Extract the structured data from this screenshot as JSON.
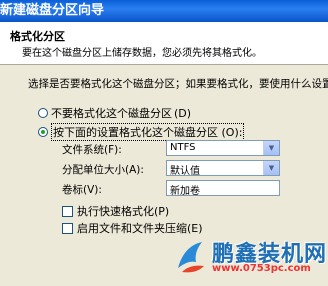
{
  "window": {
    "title": "新建磁盘分区向导"
  },
  "header": {
    "title": "格式化分区",
    "subtitle": "要在这个磁盘分区上储存数据，您必须先将其格式化。"
  },
  "instruction": "选择是否要格式化这个磁盘分区；如果要格式化，要使用什么设置。",
  "options": {
    "no_format": {
      "label": "不要格式化这个磁盘分区",
      "hotkey": "(D)",
      "selected": false
    },
    "format": {
      "label": "按下面的设置格式化这个磁盘分区",
      "hotkey": "(O):",
      "selected": true
    }
  },
  "fields": {
    "filesystem": {
      "label": "文件系统(F):",
      "value": "NTFS"
    },
    "allocation": {
      "label": "分配单位大小(A):",
      "value": "默认值"
    },
    "volume": {
      "label": "卷标(V):",
      "value": "新加卷"
    }
  },
  "checkboxes": {
    "quick_format": {
      "label": "执行快速格式化(P)",
      "checked": false
    },
    "compression": {
      "label": "启用文件和文件夹压缩(E)",
      "checked": false
    }
  },
  "watermark": {
    "name": "鹏鑫装机网",
    "url": "www.0753pc.com"
  },
  "colors": {
    "titlebar": "#0a5fd8",
    "watermark_blue": "#1f6fb5",
    "watermark_red": "#e33333"
  }
}
